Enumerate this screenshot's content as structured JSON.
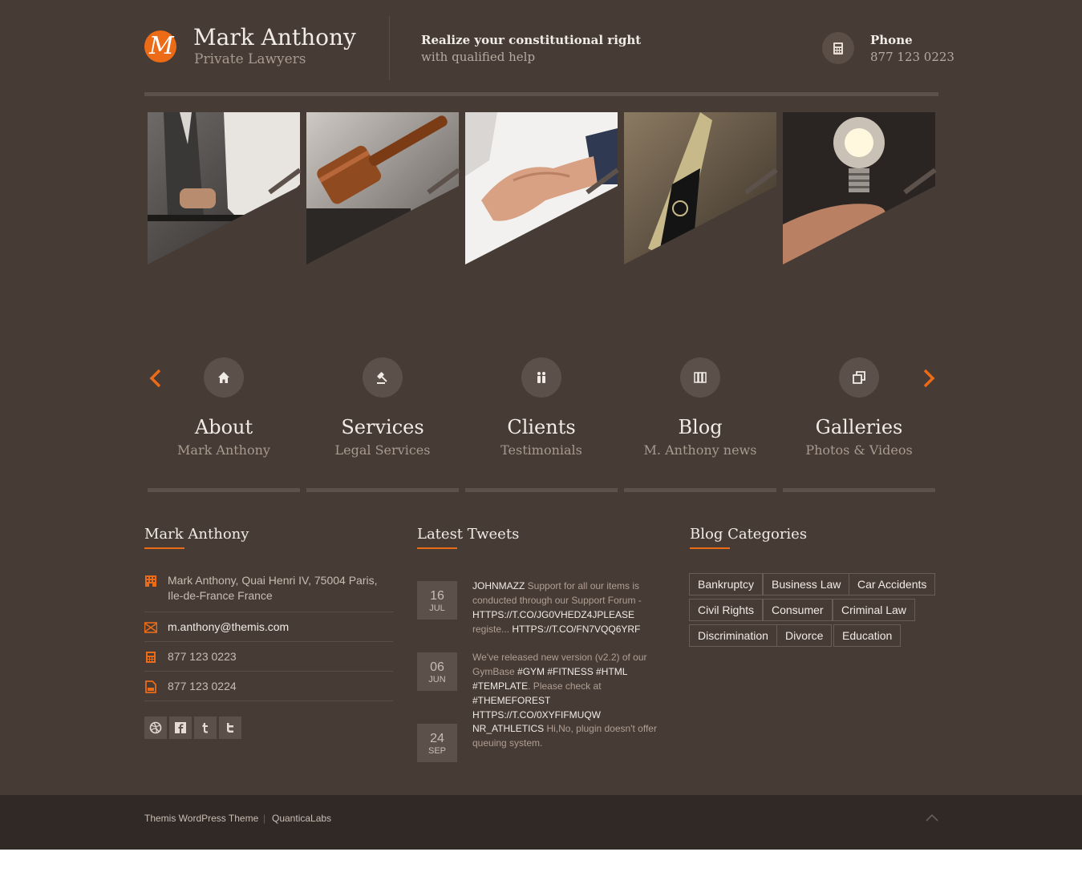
{
  "header": {
    "brand_name": "Mark Anthony",
    "brand_sub": "Private Lawyers",
    "logo_letter": "M",
    "tagline_1": "Realize your constitutional right",
    "tagline_2": "with qualified help",
    "phone_label": "Phone",
    "phone_number": "877 123 0223",
    "phone_icon": "phone-icon"
  },
  "tiles": [
    {
      "subject": "business-suit-document"
    },
    {
      "subject": "judge-gavel"
    },
    {
      "subject": "handshake"
    },
    {
      "subject": "fountain-pen"
    },
    {
      "subject": "light-bulb-in-hand"
    }
  ],
  "features": [
    {
      "title": "About",
      "subtitle": "Mark Anthony",
      "icon": "home-icon"
    },
    {
      "title": "Services",
      "subtitle": "Legal Services",
      "icon": "gavel-icon"
    },
    {
      "title": "Clients",
      "subtitle": "Testimonials",
      "icon": "people-icon"
    },
    {
      "title": "Blog",
      "subtitle": "M. Anthony news",
      "icon": "books-icon"
    },
    {
      "title": "Galleries",
      "subtitle": "Photos & Videos",
      "icon": "gallery-icon"
    }
  ],
  "contact": {
    "title": "Mark Anthony",
    "address": "Mark Anthony, Quai Henri IV, 75004 Paris, Ile-de-France France",
    "email": "m.anthony@themis.com",
    "phone": "877 123 0223",
    "fax": "877 123 0224",
    "social": [
      "dribbble-icon",
      "facebook-icon",
      "tumblr-icon",
      "twitter-icon"
    ]
  },
  "tweets": {
    "title": "Latest Tweets",
    "items": [
      {
        "day": "16",
        "month": "JUL",
        "segments": [
          {
            "t": "JOHNMAZZ",
            "h": true
          },
          {
            "t": " Support for all our items is conducted through our Support Forum - ",
            "h": false
          },
          {
            "t": "HTTPS://T.CO/JG0VHEDZ4JPLEASE",
            "h": true
          },
          {
            "t": " registe... ",
            "h": false
          },
          {
            "t": "HTTPS://T.CO/FN7VQQ6YRF",
            "h": true
          }
        ]
      },
      {
        "day": "06",
        "month": "JUN",
        "segments": [
          {
            "t": "We've released new version (v2.2) of our GymBase ",
            "h": false
          },
          {
            "t": "#GYM #FITNESS #HTML #TEMPLATE",
            "h": true
          },
          {
            "t": ". Please check at ",
            "h": false
          },
          {
            "t": "#THEMEFOREST HTTPS://T.CO/0XYFIFMUQW",
            "h": true
          }
        ]
      },
      {
        "day": "24",
        "month": "SEP",
        "segments": [
          {
            "t": "NR_ATHLETICS",
            "h": true
          },
          {
            "t": " Hi,No, plugin doesn't offer queuing system.",
            "h": false
          }
        ]
      }
    ]
  },
  "categories": {
    "title": "Blog Categories",
    "rows": [
      [
        "Bankruptcy",
        "Business Law",
        "Car Accidents"
      ],
      [
        "Civil Rights",
        "Consumer",
        "Criminal Law"
      ],
      [
        "Discrimination",
        "Divorce",
        "Education"
      ]
    ]
  },
  "footer": {
    "link_1": "Themis WordPress Theme",
    "separator": "|",
    "link_2": "QuanticaLabs",
    "scroll_top_icon": "chevron-up-icon"
  },
  "colors": {
    "accent": "#ec6b17",
    "background": "#463b35",
    "footer_bar": "#312926"
  }
}
